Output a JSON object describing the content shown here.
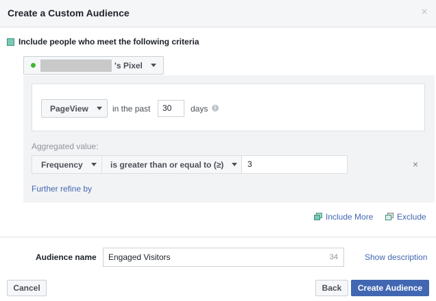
{
  "dialog": {
    "title": "Create a Custom Audience",
    "close_symbol": "×"
  },
  "criteria": {
    "include_label": "Include people who meet the following criteria",
    "pixel_suffix": "'s Pixel",
    "pixel_status_color": "#42b72a"
  },
  "event_rule": {
    "event": "PageView",
    "in_past_label": "in the past",
    "days_value": "30",
    "days_label": "days",
    "info_symbol": "i"
  },
  "aggregation": {
    "label": "Aggregated value:",
    "metric": "Frequency",
    "operator": "is greater than or equal to (≥)",
    "value": "3",
    "remove_symbol": "×",
    "refine_link": "Further refine by"
  },
  "actions": {
    "include_more": "Include More",
    "exclude": "Exclude"
  },
  "audience": {
    "name_label": "Audience name",
    "name_value": "Engaged Visitors",
    "chars_remaining": "34",
    "show_description": "Show description"
  },
  "footer": {
    "cancel": "Cancel",
    "back": "Back",
    "create": "Create Audience"
  },
  "colors": {
    "accent": "#4267b2",
    "header_bg": "#f5f6f7",
    "include_swatch": "#7cc8b6"
  }
}
